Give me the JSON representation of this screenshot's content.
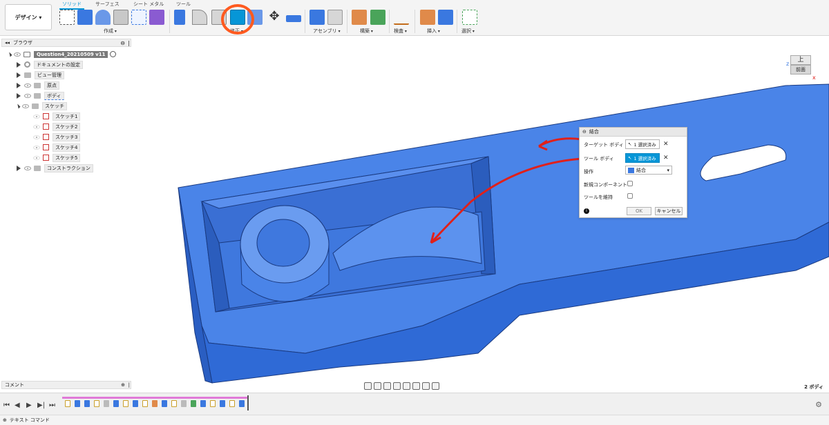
{
  "toolbar": {
    "design_label": "デザイン",
    "tabs": [
      "ソリッド",
      "サーフェス",
      "シート メタル",
      "ツール"
    ],
    "groups": {
      "create": "作成",
      "modify": "修正",
      "assemble": "アセンブリ",
      "construct": "構築",
      "inspect": "検査",
      "insert": "挿入",
      "select": "選択"
    }
  },
  "browser": {
    "title": "ブラウザ",
    "root": "Question4_20210509 v11",
    "items": [
      {
        "label": "ドキュメントの設定"
      },
      {
        "label": "ビュー管理"
      },
      {
        "label": "原点"
      },
      {
        "label": "ボディ"
      },
      {
        "label": "スケッチ"
      },
      {
        "label": "スケッチ1"
      },
      {
        "label": "スケッチ2"
      },
      {
        "label": "スケッチ3"
      },
      {
        "label": "スケッチ4"
      },
      {
        "label": "スケッチ5"
      },
      {
        "label": "コンストラクション"
      }
    ]
  },
  "viewcube": {
    "top": "上",
    "front": "前面"
  },
  "dialog": {
    "title": "結合",
    "target_label": "ターゲット ボディ",
    "target_value": "1 選択済み",
    "tool_label": "ツール ボディ",
    "tool_value": "1 選択済み",
    "operation_label": "操作",
    "operation_value": "結合",
    "new_component_label": "新規コンポーネント",
    "keep_tools_label": "ツールを維持",
    "ok": "OK",
    "cancel": "キャンセル"
  },
  "comment": {
    "label": "コメント"
  },
  "viewport_status": "2 ボディ",
  "status": {
    "text_command": "テキスト コマンド"
  },
  "colors": {
    "accent": "#0696d7",
    "body_blue": "#3a78e0",
    "annotation_red": "#e0201a",
    "highlight_orange": "#ff5a1f"
  }
}
